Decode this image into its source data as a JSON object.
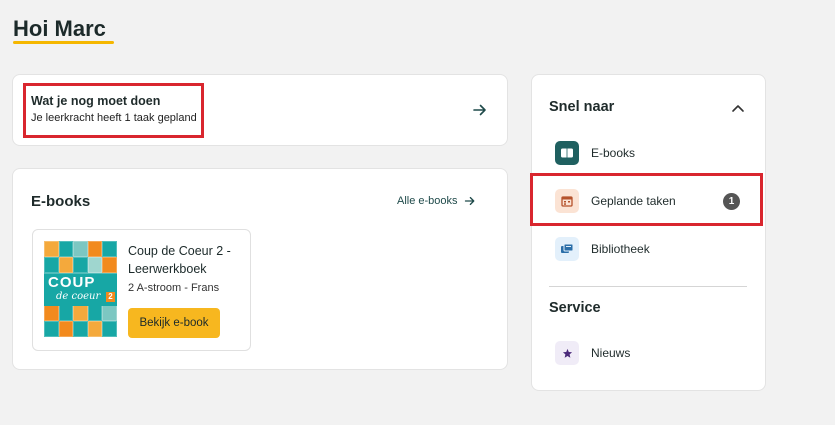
{
  "header": {
    "greeting": "Hoi Marc"
  },
  "todo": {
    "title": "Wat je nog moet doen",
    "subtitle": "Je leerkracht heeft 1 taak gepland"
  },
  "ebooks": {
    "title": "E-books",
    "all_link": "Alle e-books",
    "book": {
      "cover_word": "COUP",
      "cover_script": "de coeur",
      "cover_number": "2",
      "title": "Coup de Coeur 2 - Leerwerkboek",
      "meta": "2 A-stroom - Frans",
      "button": "Bekijk e-book"
    }
  },
  "sidebar": {
    "heading": "Snel naar",
    "items": [
      {
        "label": "E-books",
        "icon": "book-icon"
      },
      {
        "label": "Geplande taken",
        "icon": "calendar-icon",
        "badge": "1"
      },
      {
        "label": "Bibliotheek",
        "icon": "library-icon"
      }
    ],
    "service_heading": "Service",
    "service_items": [
      {
        "label": "Nieuws",
        "icon": "star-icon"
      }
    ]
  },
  "colors": {
    "accent": "#f5b700",
    "highlight": "#d9262e",
    "primary": "#1f6060",
    "button": "#f7b71f"
  }
}
